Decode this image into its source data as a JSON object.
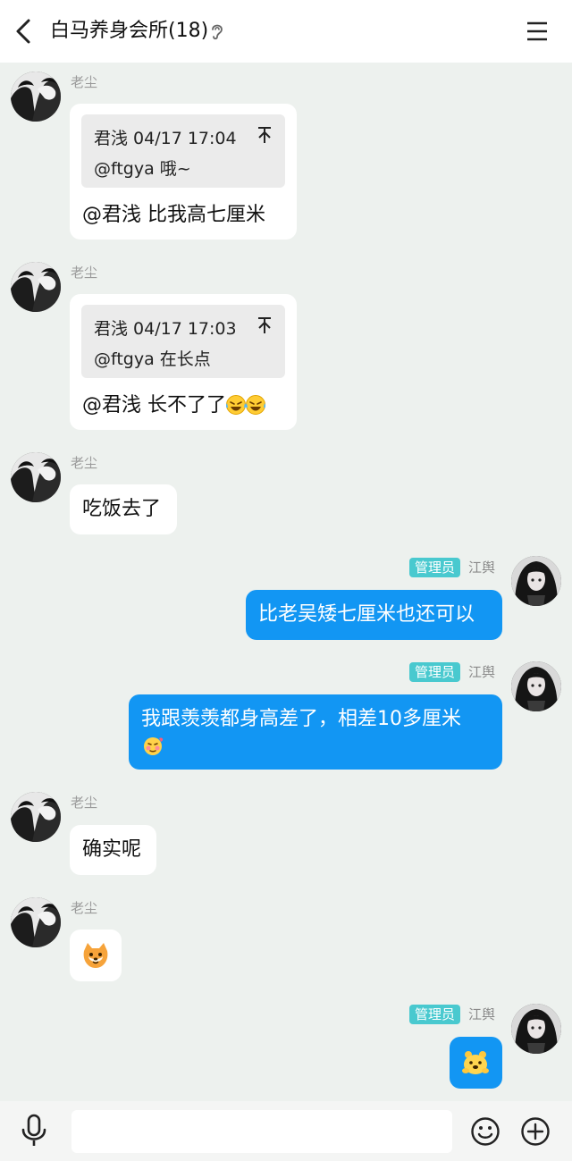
{
  "header": {
    "title": "白马养身会所(18)",
    "back_icon": "chevron-left-icon",
    "ear_icon": "ear-icon",
    "menu_icon": "hamburger-menu-icon"
  },
  "messages": [
    {
      "sender": "老尘",
      "quote": {
        "meta": "君浅 04/17 17:04",
        "text": "@ftgya 哦~"
      },
      "text": "@君浅 比我高七厘米"
    },
    {
      "sender": "老尘",
      "quote": {
        "meta": "君浅 04/17 17:03",
        "text": "@ftgya 在长点"
      },
      "text": "@君浅 长不了了"
    },
    {
      "sender": "老尘",
      "text": "吃饭去了"
    },
    {
      "sender": "江舆",
      "badge": "管理员",
      "text": "比老吴矮七厘米也还可以"
    },
    {
      "sender": "江舆",
      "badge": "管理员",
      "line1": "我跟羡羡都身高差了，相差10多厘米"
    },
    {
      "sender": "老尘",
      "text": "确实呢"
    },
    {
      "sender": "老尘",
      "sticker": "shiba-dog-emoji"
    },
    {
      "sender": "江舆",
      "badge": "管理员",
      "sticker": "bear-emoji"
    }
  ],
  "input": {
    "placeholder": "",
    "value": ""
  },
  "colors": {
    "background": "#edf1ee",
    "bubble_self": "#1296f3",
    "bubble_other": "#ffffff",
    "admin_badge": "#49c9cf"
  }
}
